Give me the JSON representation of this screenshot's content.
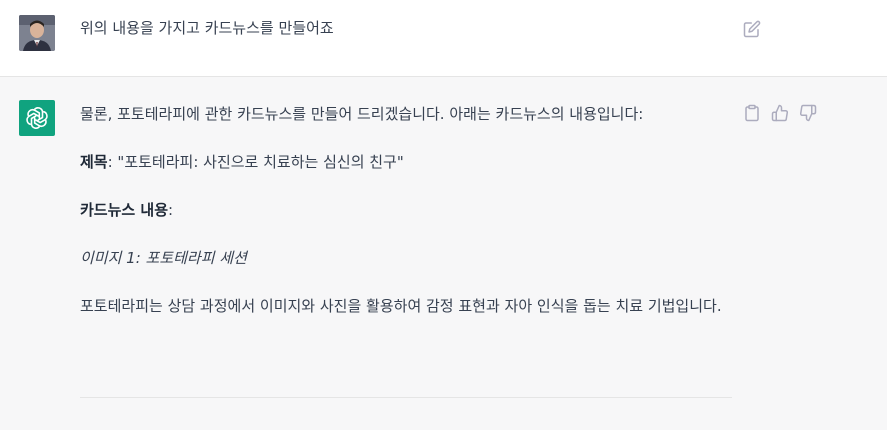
{
  "user_message": {
    "avatar_icon": "user-avatar-photo",
    "text": "위의 내용을 가지고 카드뉴스를 만들어죠",
    "edit_icon": "edit-icon"
  },
  "assistant_message": {
    "logo_icon": "openai-logo-icon",
    "intro": "물론, 포토테라피에 관한 카드뉴스를 만들어 드리겠습니다. 아래는 카드뉴스의 내용입니다:",
    "title_label": "제목",
    "title_value": ": \"포토테라피: 사진으로 치료하는 심신의 친구\"",
    "content_label": "카드뉴스 내용",
    "content_colon": ":",
    "image_caption": "이미지 1: 포토테라피 세션",
    "body": "포토테라피는 상담 과정에서 이미지와 사진을 활용하여 감정 표현과 자아 인식을 돕는 치료 기법입니다.",
    "action_icons": [
      "copy-icon",
      "thumbs-up-icon",
      "thumbs-down-icon"
    ]
  },
  "colors": {
    "accent": "#10a37f",
    "background": "#f7f7f8",
    "text": "#374151"
  }
}
